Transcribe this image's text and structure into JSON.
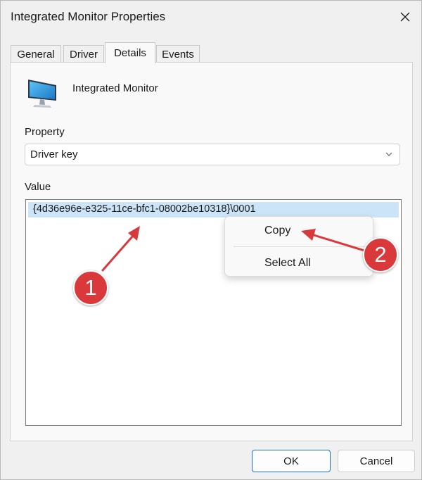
{
  "window": {
    "title": "Integrated Monitor Properties"
  },
  "tabs": [
    {
      "label": "General"
    },
    {
      "label": "Driver"
    },
    {
      "label": "Details"
    },
    {
      "label": "Events"
    }
  ],
  "device": {
    "name": "Integrated Monitor",
    "icon": "monitor-icon"
  },
  "property": {
    "label": "Property",
    "selected": "Driver key"
  },
  "value": {
    "label": "Value",
    "text": "{4d36e96e-e325-11ce-bfc1-08002be10318}\\0001"
  },
  "context_menu": {
    "items": [
      {
        "label": "Copy"
      },
      {
        "label": "Select All"
      }
    ]
  },
  "annotations": [
    {
      "label": "1"
    },
    {
      "label": "2"
    }
  ],
  "buttons": {
    "ok": "OK",
    "cancel": "Cancel"
  },
  "colors": {
    "selection": "#cce4f7",
    "annotation": "#d9393b",
    "accent": "#1f6fc5"
  }
}
